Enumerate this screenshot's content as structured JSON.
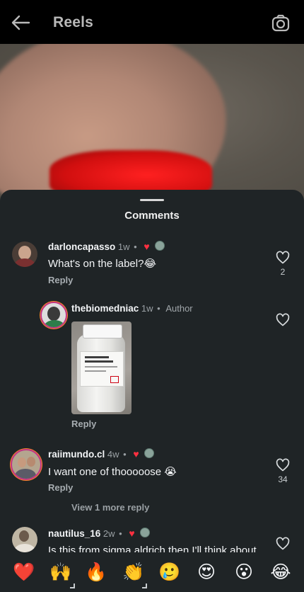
{
  "topbar": {
    "title": "Reels",
    "back_icon": "arrow-left-icon",
    "camera_icon": "camera-icon"
  },
  "sheet": {
    "title": "Comments"
  },
  "comments": [
    {
      "username": "darloncapasso",
      "time": "1w",
      "text": "What's on the label?😂",
      "reply_label": "Reply",
      "like_count": "2",
      "creator_liked": true
    },
    {
      "username": "thebiomedniac",
      "time": "1w",
      "author_tag": "Author",
      "reply_label": "Reply",
      "has_image": true
    },
    {
      "username": "raiimundo.cl",
      "time": "4w",
      "text": "I want one of thooooose 😭",
      "reply_label": "Reply",
      "like_count": "34",
      "creator_liked": true,
      "view_more": "View 1 more reply"
    },
    {
      "username": "nautilus_16",
      "time": "2w",
      "text": "Is this from sigma aldrich then I'll think about",
      "creator_liked": true
    }
  ],
  "quick_reactions": [
    "❤️",
    "🙌",
    "🔥",
    "👏",
    "🥲",
    "😍",
    "😮",
    "😂"
  ],
  "colors": {
    "sheet_bg": "#1f2426",
    "heart_red": "#ff3040",
    "text_primary": "#f3f5f7",
    "text_secondary": "#9aa0a4"
  }
}
